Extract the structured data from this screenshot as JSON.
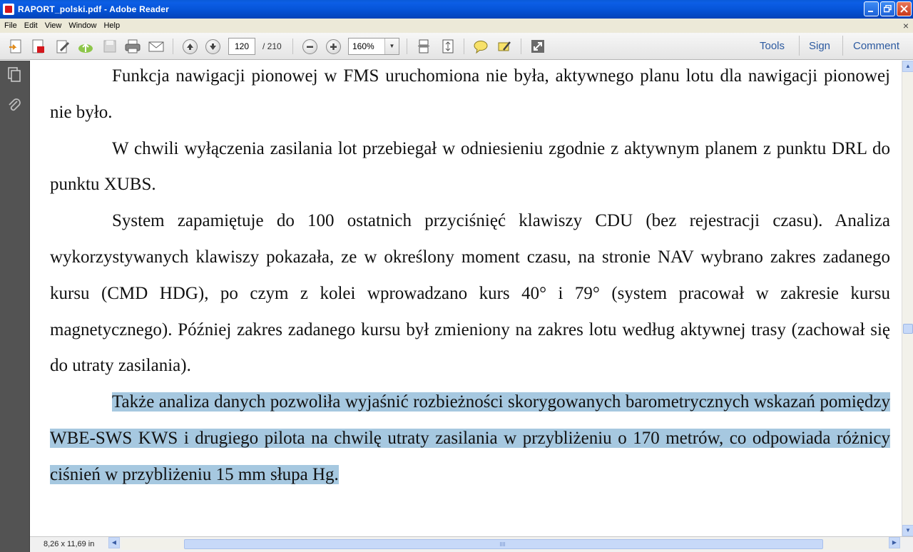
{
  "window": {
    "title": "RAPORT_polski.pdf - Adobe Reader",
    "minimize_icon": "minimize-icon",
    "maximize_icon": "restore-icon",
    "close_icon": "close-icon"
  },
  "menu": {
    "items": [
      {
        "label": "File",
        "accel": "F"
      },
      {
        "label": "Edit",
        "accel": "E"
      },
      {
        "label": "View",
        "accel": "V"
      },
      {
        "label": "Window",
        "accel": "W"
      },
      {
        "label": "Help",
        "accel": "H"
      }
    ],
    "close_glyph": "×"
  },
  "toolbar": {
    "page_current": "120",
    "page_total": "/ 210",
    "zoom": "160%",
    "tools_label": "Tools",
    "sign_label": "Sign",
    "comment_label": "Comment"
  },
  "document": {
    "paragraphs": [
      "Funkcja nawigacji pionowej w FMS uruchomiona nie była, aktywnego planu lotu dla nawigacji pionowej nie było.",
      "W chwili wyłączenia zasilania lot przebiegał w odniesieniu zgodnie z  aktywnym planem z punktu DRL do punktu XUBS.",
      "System zapamiętuje do 100 ostatnich przyciśnięć klawiszy CDU (bez rejestracji czasu). Analiza wykorzystywanych klawiszy pokazała, ze w określony moment czasu, na stronie NAV wybrano zakres zadanego kursu (CMD HDG), po czym z kolei wprowadzano kurs 40° i 79° (system pracował w zakresie kursu magnetycznego). Później zakres zadanego kursu był zmieniony na zakres lotu według aktywnej trasy (zachował się do utraty zasilania).",
      "Także analiza danych pozwoliła wyjaśnić rozbieżności skorygowanych barometrycznych wskazań pomiędzy WBE-SWS KWS i drugiego pilota na chwilę utraty zasilania w przybliżeniu o 170 metrów, co odpowiada różnicy ciśnień w przybliżeniu 15 mm słupa Hg."
    ],
    "highlighted_paragraph": 3,
    "highlight_color": "#a6c8e0"
  },
  "status": {
    "page_size": "8,26 x 11,69 in"
  },
  "colors": {
    "titlebar": "#0553d6",
    "navpane": "#535353",
    "link": "#2c5aa0"
  }
}
